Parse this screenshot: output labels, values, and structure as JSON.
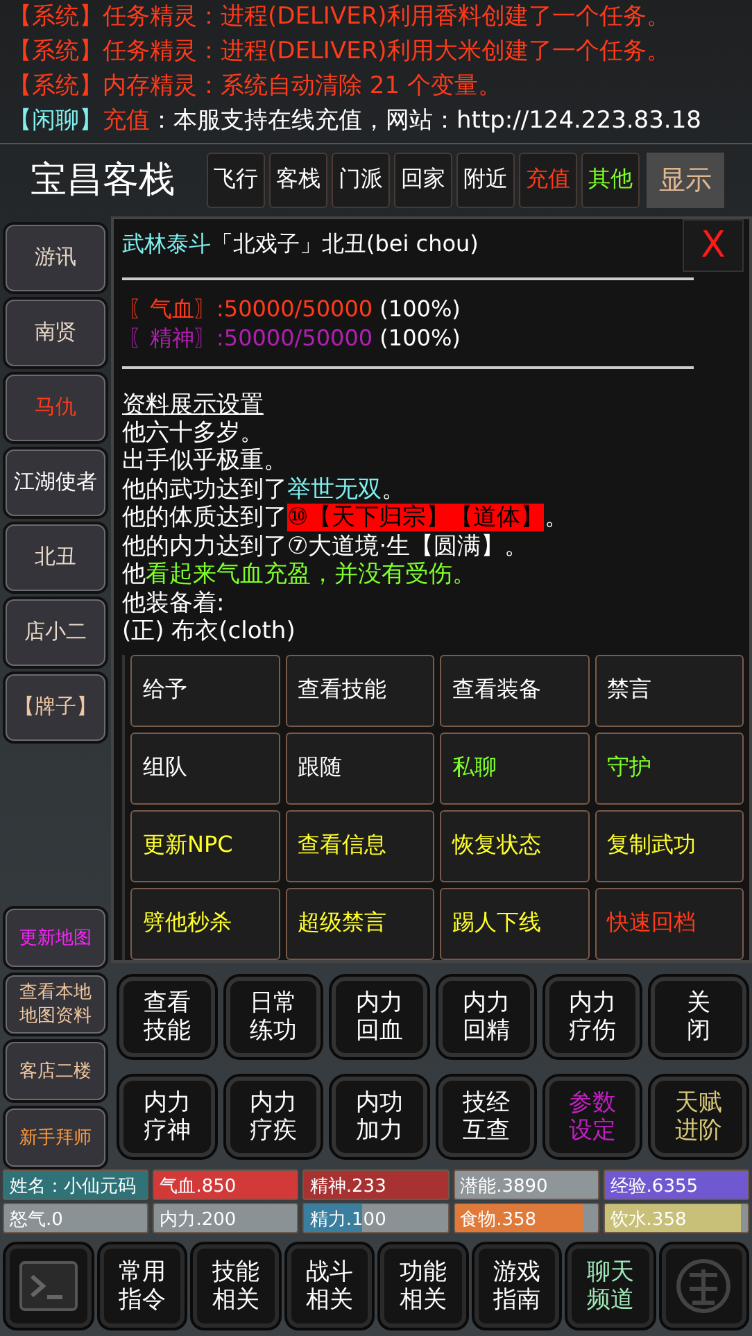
{
  "log": [
    {
      "parts": [
        {
          "text": "【系统】",
          "color": "#ff3b1a"
        },
        {
          "text": "任务精灵：进程(DELIVER)利用香料创建了一个任务。",
          "color": "#ff3b1a"
        }
      ]
    },
    {
      "parts": [
        {
          "text": "【系统】",
          "color": "#ff3b1a"
        },
        {
          "text": "任务精灵：进程(DELIVER)利用大米创建了一个任务。",
          "color": "#ff3b1a"
        }
      ]
    },
    {
      "parts": [
        {
          "text": "【系统】",
          "color": "#ff3b1a"
        },
        {
          "text": "内存精灵：系统自动清除 21 个变量。",
          "color": "#ff3b1a"
        }
      ]
    },
    {
      "parts": [
        {
          "text": "【闲聊】",
          "color": "#7ff0f0"
        },
        {
          "text": "充值",
          "color": "#ff3b1a"
        },
        {
          "text": "：本服支持在线充值，网站：http://124.223.83.18",
          "color": "#ffffff"
        }
      ]
    }
  ],
  "location": "宝昌客栈",
  "nav": [
    {
      "label": "飞行",
      "color": "#ffffff"
    },
    {
      "label": "客栈",
      "color": "#ffffff"
    },
    {
      "label": "门派",
      "color": "#ffffff"
    },
    {
      "label": "回家",
      "color": "#ffffff"
    },
    {
      "label": "附近",
      "color": "#ffffff"
    },
    {
      "label": "充值",
      "color": "#ff3b1a"
    },
    {
      "label": "其他",
      "color": "#7fff2a"
    }
  ],
  "display_button": "显示",
  "sidebar_top": [
    {
      "label": "游讯",
      "color": "#e8d8c8"
    },
    {
      "label": "南贤",
      "color": "#e8d8c8"
    },
    {
      "label": "马仇",
      "color": "#ff3b1a"
    },
    {
      "label": "江湖使者",
      "color": "#ffffff"
    },
    {
      "label": "北丑",
      "color": "#e8d8c8"
    },
    {
      "label": "店小二",
      "color": "#e8d8c8"
    },
    {
      "label": "【牌子】",
      "color": "#f0c8a0"
    }
  ],
  "sidebar_bottom": [
    {
      "label": "更新地图",
      "color": "#ff22ff"
    },
    {
      "label": "查看本地地图资料",
      "color": "#f0c8a0"
    },
    {
      "label": "客店二楼",
      "color": "#f0c8a0"
    },
    {
      "label": "新手拜师",
      "color": "#ff9a3a"
    }
  ],
  "panel": {
    "title": [
      {
        "text": "武林泰斗",
        "color": "#7ff0f0"
      },
      {
        "text": "「北戏子」北丑(bei chou)",
        "color": "#ffffff"
      }
    ],
    "close": "X",
    "stats": [
      {
        "parts": [
          {
            "text": "〖气血〗",
            "color": "#ff3b1a"
          },
          {
            "text": ":50000/50000",
            "color": "#ff3b1a"
          },
          {
            "text": " (100%)",
            "color": "#ffffff"
          }
        ]
      },
      {
        "parts": [
          {
            "text": "〖精神〗",
            "color": "#b020b0"
          },
          {
            "text": ":50000/50000",
            "color": "#b020b0"
          },
          {
            "text": " (100%)",
            "color": "#ffffff"
          }
        ]
      }
    ],
    "settings_link": "资料展示设置",
    "lines": [
      {
        "parts": [
          {
            "text": "他六十多岁。",
            "color": "#ffffff"
          }
        ]
      },
      {
        "parts": [
          {
            "text": "出手似乎极重。",
            "color": "#ffffff"
          }
        ]
      },
      {
        "parts": [
          {
            "text": "他的武功达到了",
            "color": "#ffffff"
          },
          {
            "text": "举世无双",
            "color": "#7ff0f0"
          },
          {
            "text": "。",
            "color": "#ffffff"
          }
        ]
      },
      {
        "parts": [
          {
            "text": "他的体质达到了",
            "color": "#ffffff"
          },
          {
            "text": "⑩【天下归宗】【道体】",
            "highlight": true
          },
          {
            "text": "。",
            "color": "#ffffff"
          }
        ]
      },
      {
        "parts": [
          {
            "text": "他的内力达到了⑦大道境·生【圆满】。",
            "color": "#ffffff"
          }
        ]
      },
      {
        "parts": [
          {
            "text": "他",
            "color": "#ffffff"
          },
          {
            "text": "看起来气血充盈，并没有受伤。",
            "color": "#7fff2a"
          }
        ]
      },
      {
        "parts": [
          {
            "text": "他装备着:",
            "color": "#ffffff"
          }
        ]
      },
      {
        "parts": [
          {
            "text": "(正) 布衣(cloth)",
            "color": "#ffffff"
          }
        ]
      }
    ],
    "actions": [
      {
        "label": "给予",
        "color": "#ffffff"
      },
      {
        "label": "查看技能",
        "color": "#ffffff"
      },
      {
        "label": "查看装备",
        "color": "#ffffff"
      },
      {
        "label": "禁言",
        "color": "#ffffff"
      },
      {
        "label": "组队",
        "color": "#ffffff"
      },
      {
        "label": "跟随",
        "color": "#ffffff"
      },
      {
        "label": "私聊",
        "color": "#7fff2a"
      },
      {
        "label": "守护",
        "color": "#7fff2a"
      },
      {
        "label": "更新NPC",
        "color": "#ffff2a"
      },
      {
        "label": "查看信息",
        "color": "#ffff2a"
      },
      {
        "label": "恢复状态",
        "color": "#ffff2a"
      },
      {
        "label": "复制武功",
        "color": "#ffff2a"
      },
      {
        "label": "劈他秒杀",
        "color": "#ffff2a"
      },
      {
        "label": "超级禁言",
        "color": "#ffff2a"
      },
      {
        "label": "踢人下线",
        "color": "#ffff2a"
      },
      {
        "label": "快速回档",
        "color": "#ff3b1a"
      }
    ]
  },
  "quick": [
    {
      "label": "查看技能",
      "color": "#ffffff"
    },
    {
      "label": "日常练功",
      "color": "#ffffff"
    },
    {
      "label": "内力回血",
      "color": "#ffffff"
    },
    {
      "label": "内力回精",
      "color": "#ffffff"
    },
    {
      "label": "内力疗伤",
      "color": "#ffffff"
    },
    {
      "label": "关闭",
      "color": "#ffffff"
    },
    {
      "label": "内力疗神",
      "color": "#ffffff"
    },
    {
      "label": "内力疗疾",
      "color": "#ffffff"
    },
    {
      "label": "内功加力",
      "color": "#ffffff"
    },
    {
      "label": "技经互查",
      "color": "#ffffff"
    },
    {
      "label": "参数设定",
      "color": "#c020c0"
    },
    {
      "label": "天赋进阶",
      "color": "#d8c878"
    }
  ],
  "bars": [
    {
      "label": "姓名：小仙元码",
      "level": 1,
      "color": "#2f7379"
    },
    {
      "label": "气血.850",
      "level": 1,
      "color": "#d23a3a"
    },
    {
      "label": "精神.233",
      "level": 1,
      "color": "#a83232"
    },
    {
      "label": "潜能.3890",
      "level": 1,
      "color": "#8f9699"
    },
    {
      "label": "经验.6355",
      "level": 1,
      "color": "#7058d0"
    },
    {
      "label": "怒气.0"
    },
    {
      "label": "内力.200"
    },
    {
      "label": "精力.100",
      "level": 0.4,
      "color": "#3a7fa0"
    },
    {
      "label": "食物.358",
      "level": 0.9,
      "color": "#e07a3a"
    },
    {
      "label": "饮水.358",
      "level": 0.95,
      "color": "#c8c078"
    }
  ],
  "bottom": [
    {
      "kind": "terminal"
    },
    {
      "kind": "text",
      "label": "常用指令",
      "color": "#ffffff"
    },
    {
      "kind": "text",
      "label": "技能相关",
      "color": "#ffffff"
    },
    {
      "kind": "text",
      "label": "战斗相关",
      "color": "#ffffff"
    },
    {
      "kind": "text",
      "label": "功能相关",
      "color": "#ffffff"
    },
    {
      "kind": "text",
      "label": "游戏指南",
      "color": "#ffffff"
    },
    {
      "kind": "text",
      "label": "聊天频道",
      "color": "#a0e8b8"
    },
    {
      "kind": "ornament"
    }
  ]
}
